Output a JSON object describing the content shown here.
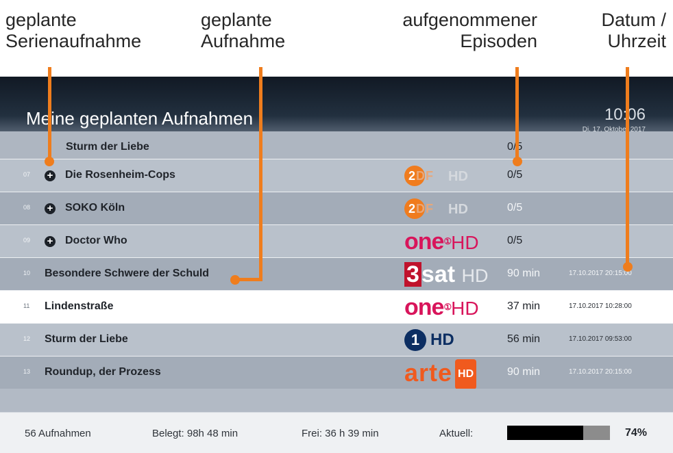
{
  "annotations": [
    {
      "text": "geplante\nSerienaufnahme"
    },
    {
      "text": "geplante\nAufnahme"
    },
    {
      "text": "aufgenommener\nEpisoden"
    },
    {
      "text": "Datum /\nUhrzeit"
    }
  ],
  "header": {
    "title": "Meine geplanten Aufnahmen",
    "time": "10:06",
    "date": "Di, 17. Oktober 2017"
  },
  "partial_row": {
    "title": "Sturm der Liebe",
    "value": "0/5"
  },
  "rows": [
    {
      "num": "07",
      "title": "Die Rosenheim-Cops",
      "channel": "ZDF HD",
      "value": "0/5",
      "stamp": ""
    },
    {
      "num": "08",
      "title": "SOKO Köln",
      "channel": "ZDF HD",
      "value": "0/5",
      "stamp": ""
    },
    {
      "num": "09",
      "title": "Doctor Who",
      "channel": "one HD",
      "value": "0/5",
      "stamp": ""
    },
    {
      "num": "10",
      "title": "Besondere Schwere der Schuld",
      "channel": "3sat HD",
      "value": "90 min",
      "stamp": "17.10.2017 20:15:00"
    },
    {
      "num": "11",
      "title": "Lindenstraße",
      "channel": "one HD",
      "value": "37 min",
      "stamp": "17.10.2017 10:28:00"
    },
    {
      "num": "12",
      "title": "Sturm der Liebe",
      "channel": "Das Erste HD",
      "value": "56 min",
      "stamp": "17.10.2017 09:53:00"
    },
    {
      "num": "13",
      "title": "Roundup, der Prozess",
      "channel": "arte HD",
      "value": "90 min",
      "stamp": "17.10.2017 20:15:00"
    }
  ],
  "logos": {
    "one": {
      "word": "one",
      "mark": "①",
      "hd": "HD"
    },
    "zdf": {
      "two": "2",
      "df": "DF",
      "hd": "HD"
    },
    "sat": {
      "three": "3",
      "word": "sat",
      "hd": "HD"
    },
    "ard": {
      "one": "1",
      "hd": "HD"
    },
    "arte": {
      "word": "arte",
      "hd": "HD"
    }
  },
  "icons": {
    "series": "plus-circle-icon"
  },
  "status": {
    "count": "56 Aufnahmen",
    "used": "Belegt: 98h 48 min",
    "free": "Frei: 36 h 39 min",
    "current_label": "Aktuell:",
    "usage_fraction": 0.74,
    "usage_text": "74%"
  },
  "colors": {
    "callout": "#ef7d1d",
    "one": "#d8155b",
    "zdf": "#f07c1e",
    "sat": "#c0122c",
    "ard": "#0c2e62",
    "arte": "#f05a1e"
  }
}
